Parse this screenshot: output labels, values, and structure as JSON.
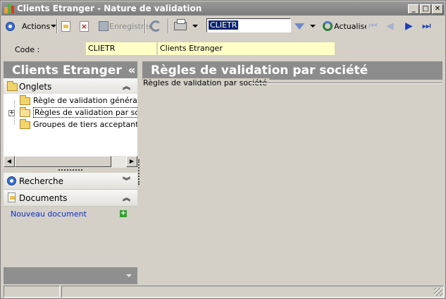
{
  "window": {
    "title": "Clients Etranger -  Nature de validation",
    "buttons": {
      "minimize": "_",
      "maximize": "□",
      "close": "✕"
    }
  },
  "toolbar": {
    "actions_label": "Actions",
    "save_label": "Enregistrer",
    "search_value": "CLIETR",
    "refresh_label": "Actualiser",
    "icons": [
      "actions-icon",
      "new-icon",
      "delete-icon",
      "save-icon",
      "refresh-icon",
      "print-icon",
      "filter-icon",
      "actualise-icon",
      "first-icon",
      "previous-icon",
      "next-icon",
      "last-icon"
    ]
  },
  "form": {
    "code_label": "Code :",
    "code_value": "CLIETR",
    "name_value": "Clients Etranger"
  },
  "left_panel": {
    "title": "Clients Etranger",
    "collapse_glyph": "«",
    "onglets": {
      "label": "Onglets",
      "chevron": "⌃",
      "items": [
        {
          "label": "Règle de validation générale"
        },
        {
          "label": "Règles de validation par société"
        },
        {
          "label": "Groupes de tiers acceptant la n"
        }
      ],
      "expander": "+"
    },
    "recherche": {
      "label": "Recherche",
      "chevron": "⌄"
    },
    "documents": {
      "label": "Documents",
      "chevron": "⌃",
      "new_link": "Nouveau document",
      "add_glyph": "+"
    }
  },
  "main": {
    "title": "Règles de validation par société",
    "group_label": "Règles de validation par société"
  },
  "colors": {
    "header_bg": "#8c8c8c",
    "field_bg": "#ffffc8",
    "link": "#0b2fc1"
  }
}
